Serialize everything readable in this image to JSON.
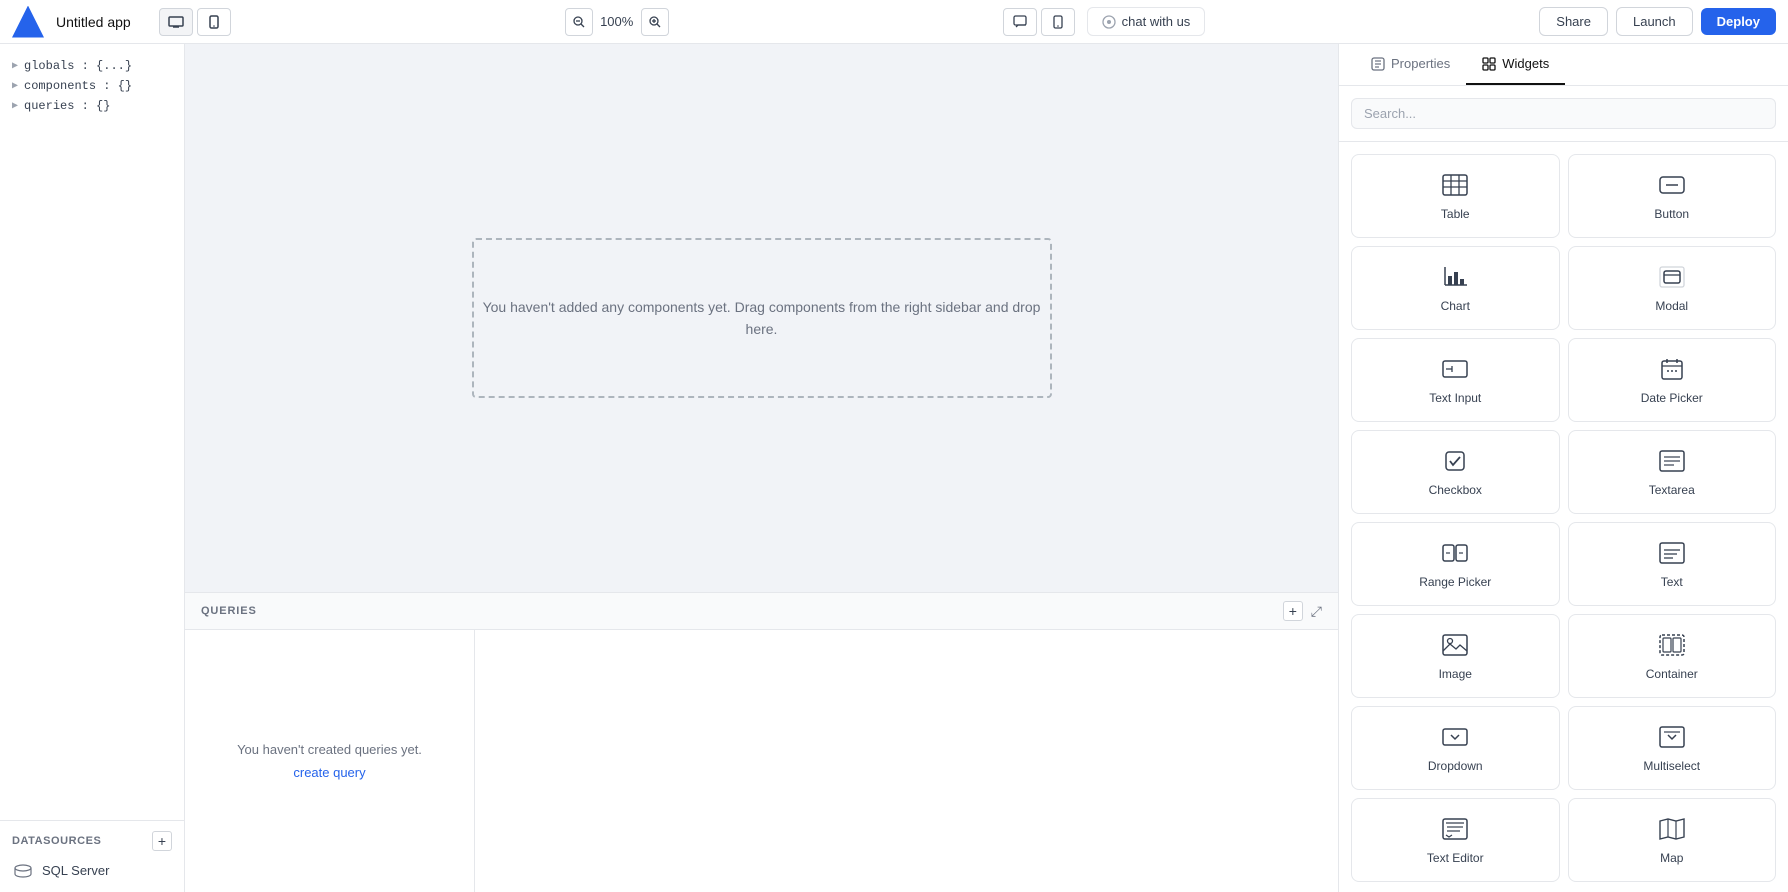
{
  "topbar": {
    "app_title": "Untitled app",
    "zoom_value": "100%",
    "chat_label": "chat with us",
    "share_label": "Share",
    "launch_label": "Launch",
    "deploy_label": "Deploy"
  },
  "left_sidebar": {
    "tree_items": [
      {
        "label": "globals : {...}"
      },
      {
        "label": "components : {}"
      },
      {
        "label": "queries : {}"
      }
    ],
    "datasources": {
      "label": "DATASOURCES",
      "items": [
        {
          "label": "SQL Server"
        }
      ]
    }
  },
  "canvas": {
    "drop_zone_text": "You haven't added any components yet. Drag components from the right sidebar\nand drop here."
  },
  "queries_panel": {
    "label": "QUERIES",
    "empty_text": "You haven't created queries yet.",
    "create_query_label": "create query"
  },
  "right_sidebar": {
    "tabs": [
      {
        "label": "Properties",
        "active": false
      },
      {
        "label": "Widgets",
        "active": true
      }
    ],
    "search": {
      "placeholder": "Search..."
    },
    "widgets": [
      {
        "label": "Table",
        "icon": "table-icon"
      },
      {
        "label": "Button",
        "icon": "button-icon"
      },
      {
        "label": "Chart",
        "icon": "chart-icon"
      },
      {
        "label": "Modal",
        "icon": "modal-icon"
      },
      {
        "label": "Text Input",
        "icon": "text-input-icon"
      },
      {
        "label": "Date Picker",
        "icon": "date-picker-icon"
      },
      {
        "label": "Checkbox",
        "icon": "checkbox-icon"
      },
      {
        "label": "Textarea",
        "icon": "textarea-icon"
      },
      {
        "label": "Range Picker",
        "icon": "range-picker-icon"
      },
      {
        "label": "Text",
        "icon": "text-icon"
      },
      {
        "label": "Image",
        "icon": "image-icon"
      },
      {
        "label": "Container",
        "icon": "container-icon"
      },
      {
        "label": "Dropdown",
        "icon": "dropdown-icon"
      },
      {
        "label": "Multiselect",
        "icon": "multiselect-icon"
      },
      {
        "label": "Text Editor",
        "icon": "text-editor-icon"
      },
      {
        "label": "Map",
        "icon": "map-icon"
      }
    ]
  }
}
